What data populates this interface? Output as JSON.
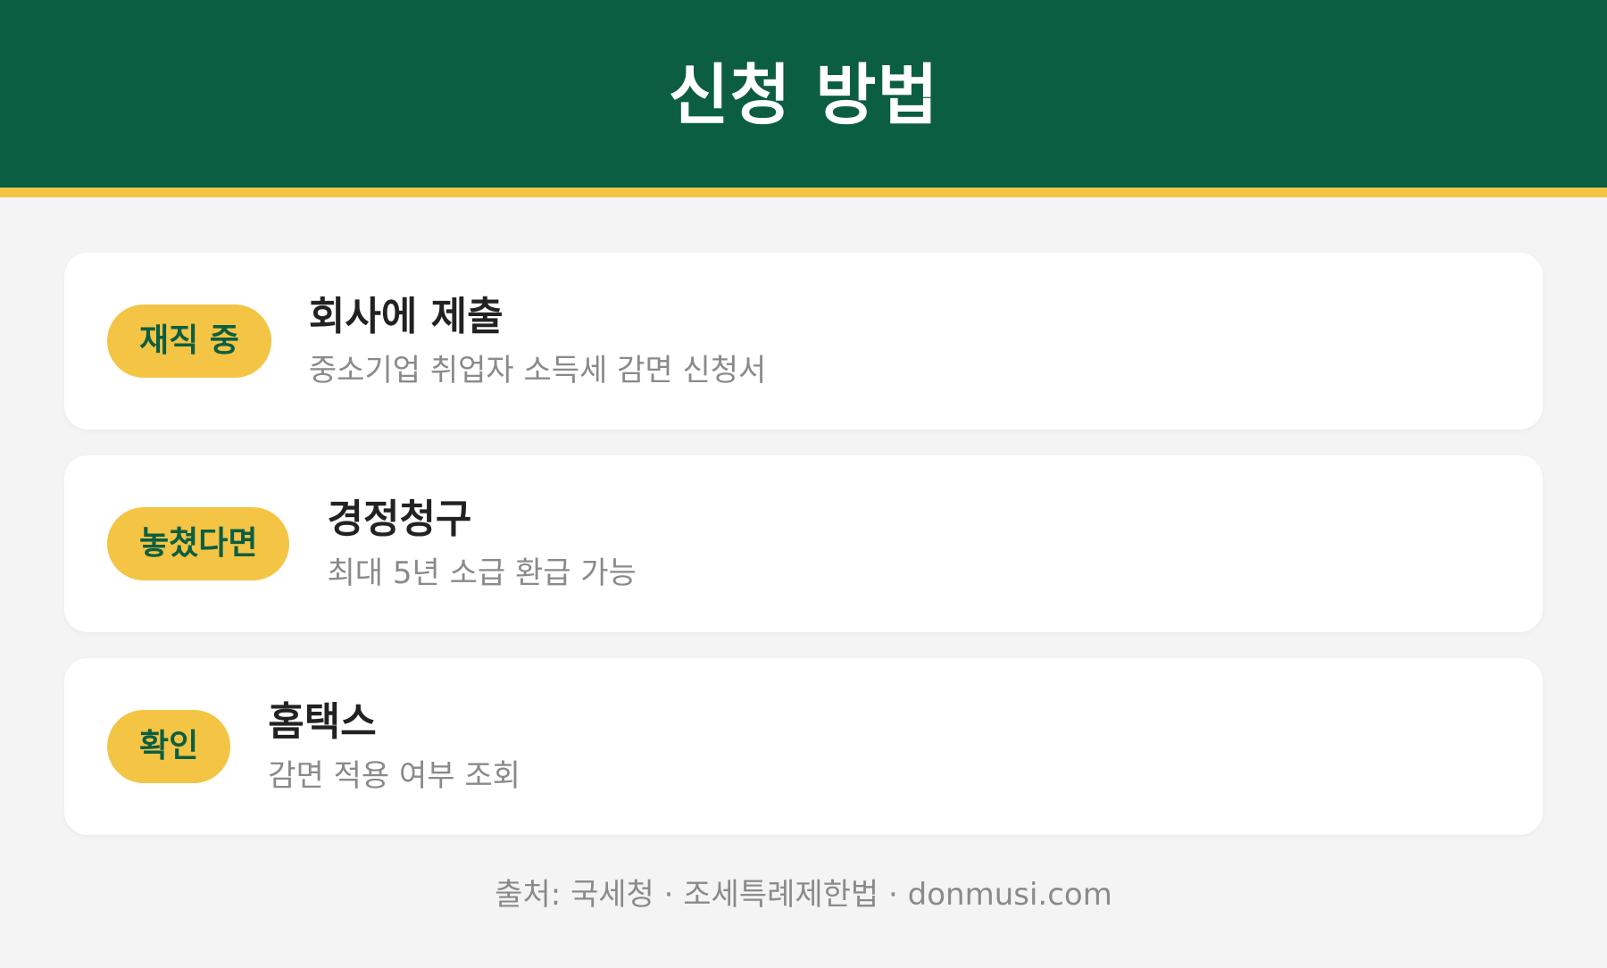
{
  "header": {
    "title": "신청 방법"
  },
  "steps": [
    {
      "badge": "재직 중",
      "title": "회사에 제출",
      "description": "중소기업 취업자 소득세 감면 신청서"
    },
    {
      "badge": "놓쳤다면",
      "title": "경정청구",
      "description": "최대 5년 소급 환급 가능"
    },
    {
      "badge": "확인",
      "title": "홈택스",
      "description": "감면 적용 여부 조회"
    }
  ],
  "footer": {
    "text": "출처: 국세청 · 조세특례제한법 · donmusi.com"
  },
  "colors": {
    "header_background": "#0b5e41",
    "accent": "#f4c444",
    "page_background": "#f3f4f3",
    "card_background": "#ffffff"
  }
}
